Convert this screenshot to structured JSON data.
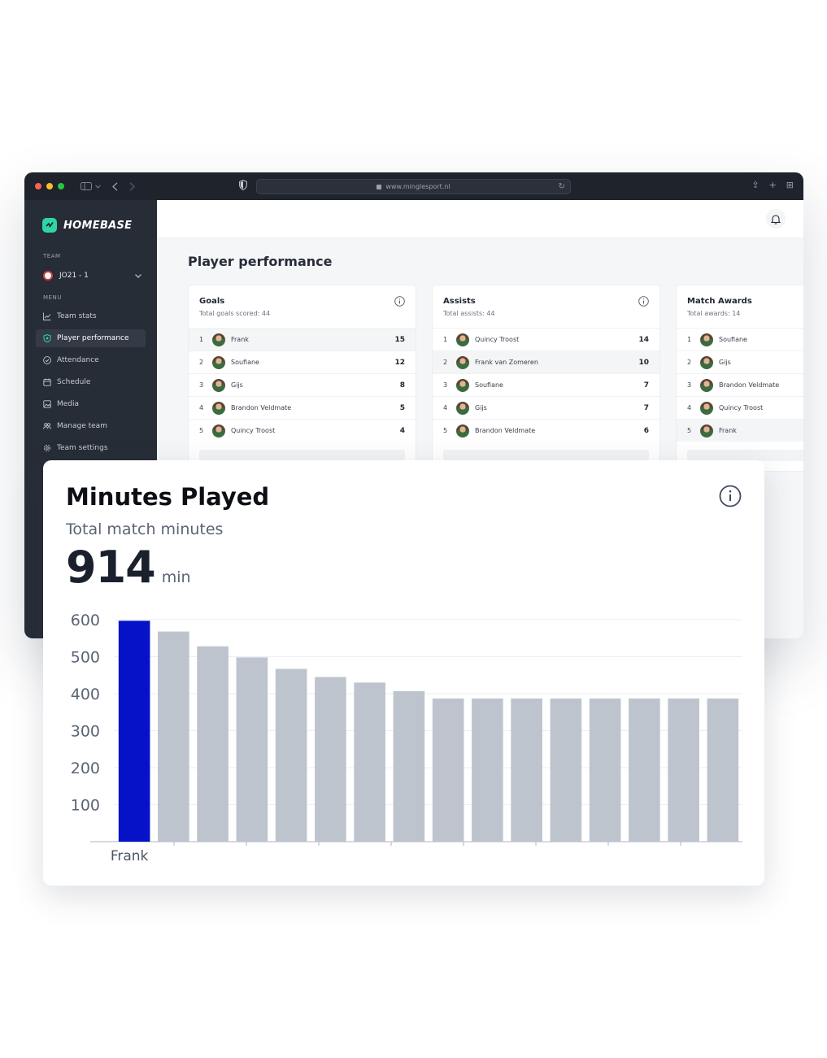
{
  "browser": {
    "url": "www.minglesport.nl"
  },
  "sidebar": {
    "logo": "HOMEBASE",
    "team_label": "TEAM",
    "team_name": "JO21 - 1",
    "menu_label": "MENU",
    "items": [
      {
        "label": "Team stats",
        "icon": "chart-line-icon"
      },
      {
        "label": "Player performance",
        "icon": "shield-icon",
        "active": true
      },
      {
        "label": "Attendance",
        "icon": "check-circle-icon"
      },
      {
        "label": "Schedule",
        "icon": "calendar-icon"
      },
      {
        "label": "Media",
        "icon": "image-icon"
      },
      {
        "label": "Manage team",
        "icon": "users-icon"
      },
      {
        "label": "Team settings",
        "icon": "gear-icon"
      }
    ]
  },
  "page": {
    "title": "Player performance"
  },
  "cards": [
    {
      "title": "Goals",
      "subtitle": "Total goals scored: 44",
      "rows": [
        {
          "rank": "1",
          "name": "Frank",
          "value": "15"
        },
        {
          "rank": "2",
          "name": "Soufiane",
          "value": "12"
        },
        {
          "rank": "3",
          "name": "Gijs",
          "value": "8"
        },
        {
          "rank": "4",
          "name": "Brandon Veldmate",
          "value": "5"
        },
        {
          "rank": "5",
          "name": "Quincy Troost",
          "value": "4"
        }
      ]
    },
    {
      "title": "Assists",
      "subtitle": "Total assists: 44",
      "rows": [
        {
          "rank": "1",
          "name": "Quincy Troost",
          "value": "14"
        },
        {
          "rank": "2",
          "name": "Frank van Zomeren",
          "value": "10"
        },
        {
          "rank": "3",
          "name": "Soufiane",
          "value": "7"
        },
        {
          "rank": "4",
          "name": "Gijs",
          "value": "7"
        },
        {
          "rank": "5",
          "name": "Brandon Veldmate",
          "value": "6"
        }
      ]
    },
    {
      "title": "Match Awards",
      "subtitle": "Total awards: 14",
      "rows": [
        {
          "rank": "1",
          "name": "Soufiane",
          "value": ""
        },
        {
          "rank": "2",
          "name": "Gijs",
          "value": ""
        },
        {
          "rank": "3",
          "name": "Brandon Veldmate",
          "value": ""
        },
        {
          "rank": "4",
          "name": "Quincy Troost",
          "value": ""
        },
        {
          "rank": "5",
          "name": "Frank",
          "value": ""
        }
      ]
    }
  ],
  "minutes_card": {
    "title": "Minutes Played",
    "subtitle": "Total match minutes",
    "total": "914",
    "unit": "min"
  },
  "chart_data": {
    "type": "bar",
    "categories": [
      "Frank",
      "",
      "",
      "",
      "",
      "",
      "",
      "",
      "",
      "",
      "",
      "",
      "",
      "",
      "",
      ""
    ],
    "values": [
      597,
      568,
      528,
      498,
      467,
      445,
      430,
      407,
      387,
      387,
      387,
      387,
      387,
      387,
      387,
      387
    ],
    "highlight_index": 0,
    "yticks": [
      100,
      200,
      300,
      400,
      500,
      600
    ],
    "ylim": [
      0,
      600
    ],
    "grid": true,
    "colors": {
      "highlight": "#0512c7",
      "bar": "#bec4ce",
      "grid": "#eceef1"
    }
  }
}
